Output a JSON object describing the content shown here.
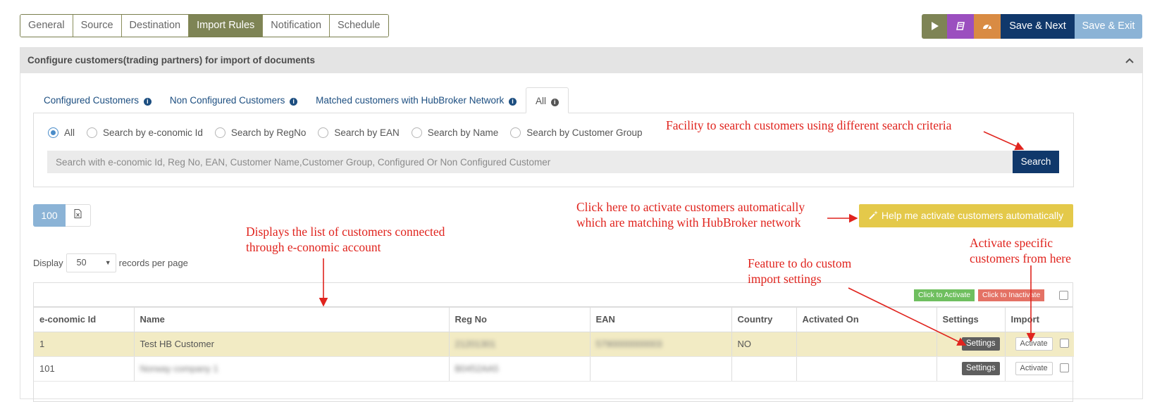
{
  "wizard": {
    "tabs": [
      "General",
      "Source",
      "Destination",
      "Import Rules",
      "Notification",
      "Schedule"
    ],
    "active": "Import Rules"
  },
  "actions": {
    "play_icon": "play-icon",
    "book_icon": "book-icon",
    "gauge_icon": "dashboard-icon",
    "save_next": "Save & Next",
    "save_exit": "Save & Exit",
    "colors": {
      "olive": "#7e8455",
      "purple": "#9b4fbf",
      "orange": "#d98b43",
      "navy": "#10386b",
      "light_blue": "#8bb3d6"
    }
  },
  "panel": {
    "title": "Configure customers(trading partners) for import of documents",
    "customer_tabs": [
      "Configured Customers",
      "Non Configured Customers",
      "Matched customers with HubBroker Network",
      "All"
    ],
    "active_tab": "All",
    "search_options": [
      "All",
      "Search by e-conomic Id",
      "Search by RegNo",
      "Search by EAN",
      "Search by Name",
      "Search by Customer Group"
    ],
    "selected_option": "All",
    "search_placeholder": "Search with e-conomic Id, Reg No, EAN, Customer Name,Customer Group, Configured Or Non Configured Customer",
    "search_button": "Search",
    "page_size_button": "100",
    "help_button": "Help me activate customers automatically",
    "display_label": "Display",
    "display_value": "50",
    "records_label": "records per page"
  },
  "table": {
    "activate_all": "Click to Activate",
    "inactivate_all": "Click to Inactivate",
    "columns": [
      "e-conomic Id",
      "Name",
      "Reg No",
      "EAN",
      "Country",
      "Activated On",
      "Settings",
      "Import"
    ],
    "rows": [
      {
        "id": "1",
        "name": "Test HB Customer",
        "regno": "21201301",
        "ean": "5790000000003",
        "country": "NO",
        "activated_on": "",
        "settings": "Settings",
        "import": "Activate"
      },
      {
        "id": "101",
        "name": "Norway company 1",
        "regno": "B0452AA5",
        "ean": "",
        "country": "",
        "activated_on": "",
        "settings": "Settings",
        "import": "Activate"
      }
    ]
  },
  "annotations": {
    "search": "Facility to search customers using different search criteria",
    "auto_1": "Click here to activate customers automatically",
    "auto_2": "which are matching with HubBroker network",
    "list_1": "Displays the list of customers connected",
    "list_2": "through e-conomic account",
    "settings_1": "Feature to do custom",
    "settings_2": "import settings",
    "activate_1": "Activate specific",
    "activate_2": "customers from here",
    "color": "#e0241e"
  }
}
